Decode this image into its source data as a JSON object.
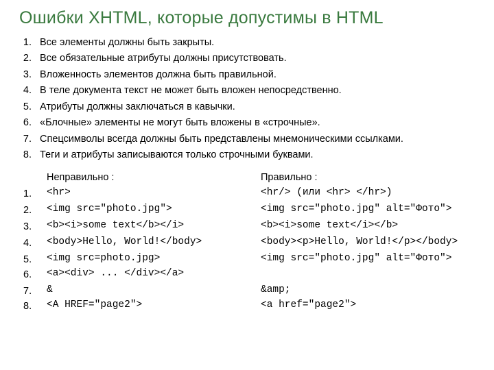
{
  "title": "Ошибки XHTML, которые допустимы в HTML",
  "rules": [
    "Все элементы должны быть закрыты.",
    "Все обязательные атрибуты должны присутствовать.",
    "Вложенность элементов должна быть правильной.",
    "В теле документа текст не может быть вложен непосредственно.",
    "Атрибуты должны заключаться в кавычки.",
    "«Блочные» элементы не могут быть вложены в «строчные».",
    "Спецсимволы всегда должны быть представлены мнемоническими ссылками.",
    "Теги и атрибуты записываются только строчными буквами."
  ],
  "headers": {
    "wrong": "Неправильно :",
    "right": "Правильно :"
  },
  "nums": [
    "1.",
    "2.",
    "3.",
    "4.",
    "5.",
    "6.",
    "7.",
    "8."
  ],
  "wrong": [
    "<hr>",
    "<img src=\"photo.jpg\">",
    "<b><i>some text</b></i>",
    "<body>Hello, World!</body>",
    "<img src=photo.jpg>",
    "<a><div> ... </div></a>",
    "&",
    "<A HREF=\"page2\">"
  ],
  "right": [
    "<hr/> (или <hr> </hr>)",
    "<img src=\"photo.jpg\" alt=\"Фото\">",
    "<b><i>some text</i></b>",
    "<body><p>Hello, World!</p></body>",
    "<img src=\"photo.jpg\" alt=\"Фото\">",
    "",
    "&amp;",
    "<a href=\"page2\">"
  ]
}
